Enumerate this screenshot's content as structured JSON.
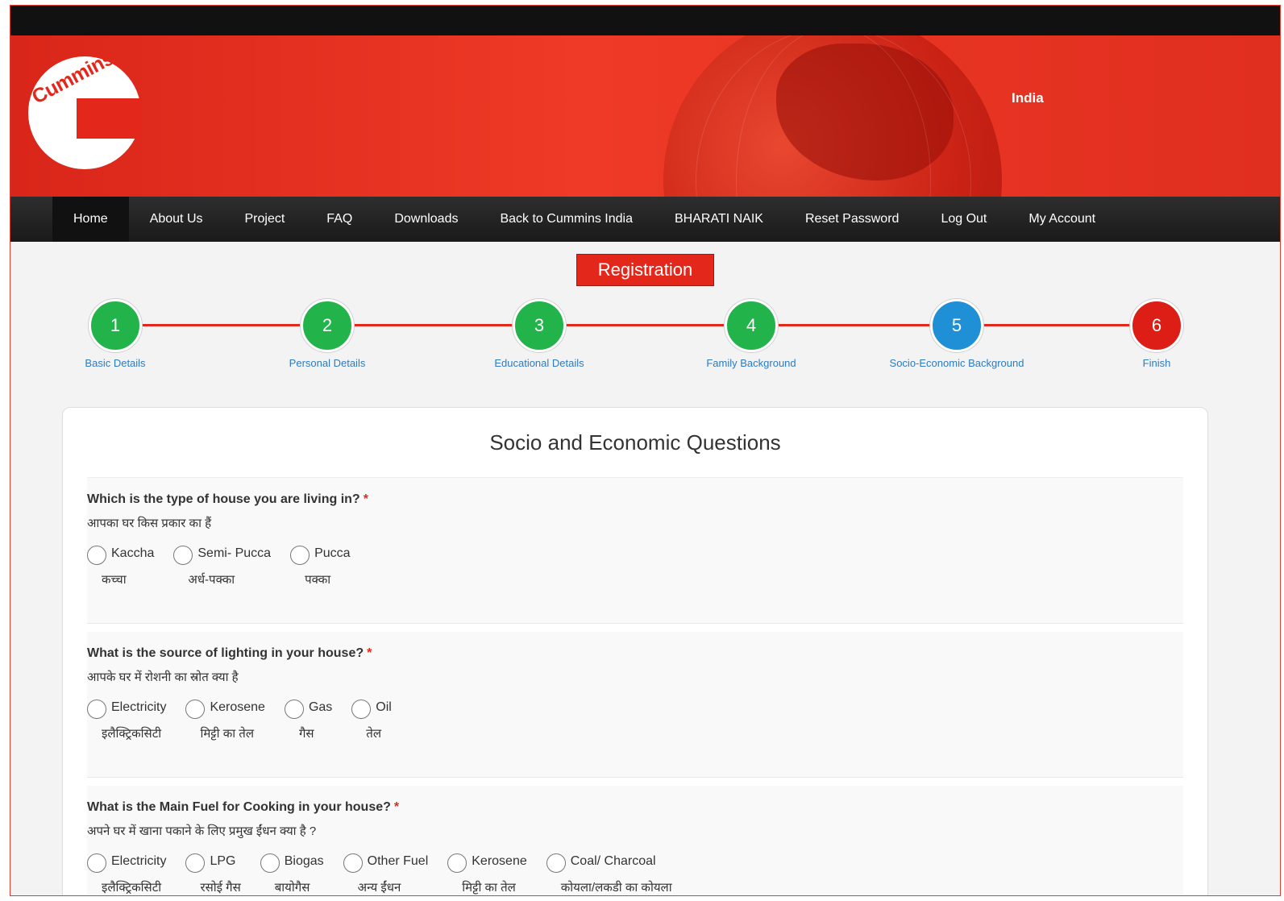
{
  "header": {
    "country": "India",
    "logo_text": "Cummins",
    "colors": {
      "brand_red": "#e3281b",
      "nav_dark": "#1f1f1f",
      "top_bar": "#111111"
    }
  },
  "nav": {
    "items": [
      {
        "label": "Home"
      },
      {
        "label": "About Us"
      },
      {
        "label": "Project"
      },
      {
        "label": "FAQ"
      },
      {
        "label": "Downloads"
      },
      {
        "label": "Back to Cummins India"
      },
      {
        "label": "BHARATI NAIK"
      },
      {
        "label": "Reset Password"
      },
      {
        "label": "Log Out"
      },
      {
        "label": "My Account"
      }
    ],
    "active_index": 0
  },
  "registration_button": "Registration",
  "steps": [
    {
      "number": "1",
      "label": "Basic Details",
      "status": "complete",
      "color": "#22b44a"
    },
    {
      "number": "2",
      "label": "Personal Details",
      "status": "complete",
      "color": "#22b44a"
    },
    {
      "number": "3",
      "label": "Educational Details",
      "status": "complete",
      "color": "#22b44a"
    },
    {
      "number": "4",
      "label": "Family Background",
      "status": "complete",
      "color": "#22b44a"
    },
    {
      "number": "5",
      "label": "Socio-Economic Background",
      "status": "current",
      "color": "#1f8fd6"
    },
    {
      "number": "6",
      "label": "Finish",
      "status": "pending",
      "color": "#dc1e16"
    }
  ],
  "form": {
    "title": "Socio and Economic Questions",
    "required_marker": "*",
    "questions": [
      {
        "question": "Which is the type of house you are living in?",
        "hindi": "आपका घर किस प्रकार का हैं",
        "options": [
          {
            "en": "Kaccha",
            "hi": "कच्चा"
          },
          {
            "en": "Semi- Pucca",
            "hi": "अर्ध-पक्का"
          },
          {
            "en": "Pucca",
            "hi": "पक्का"
          }
        ]
      },
      {
        "question": "What is the source of lighting in your house?",
        "hindi": "आपके घर में रोशनी का स्रोत क्या है",
        "options": [
          {
            "en": "Electricity",
            "hi": "इलैक्ट्रिकसिटी"
          },
          {
            "en": "Kerosene",
            "hi": "मिट्टी का तेल"
          },
          {
            "en": "Gas",
            "hi": "गैस"
          },
          {
            "en": "Oil",
            "hi": "तेल"
          }
        ]
      },
      {
        "question": "What is the Main Fuel for Cooking in your house?",
        "hindi": "अपने घर में खाना पकाने के लिए प्रमुख ईंधन क्या है ?",
        "options": [
          {
            "en": "Electricity",
            "hi": "इलैक्ट्रिकसिटी"
          },
          {
            "en": "LPG",
            "hi": "रसोई गैस"
          },
          {
            "en": "Biogas",
            "hi": "बायोगैस"
          },
          {
            "en": "Other Fuel",
            "hi": "अन्य ईंधन"
          },
          {
            "en": "Kerosene",
            "hi": "मिट्टी का तेल"
          },
          {
            "en": "Coal/ Charcoal",
            "hi": "कोयला/लकडी का कोयला"
          }
        ]
      }
    ]
  }
}
